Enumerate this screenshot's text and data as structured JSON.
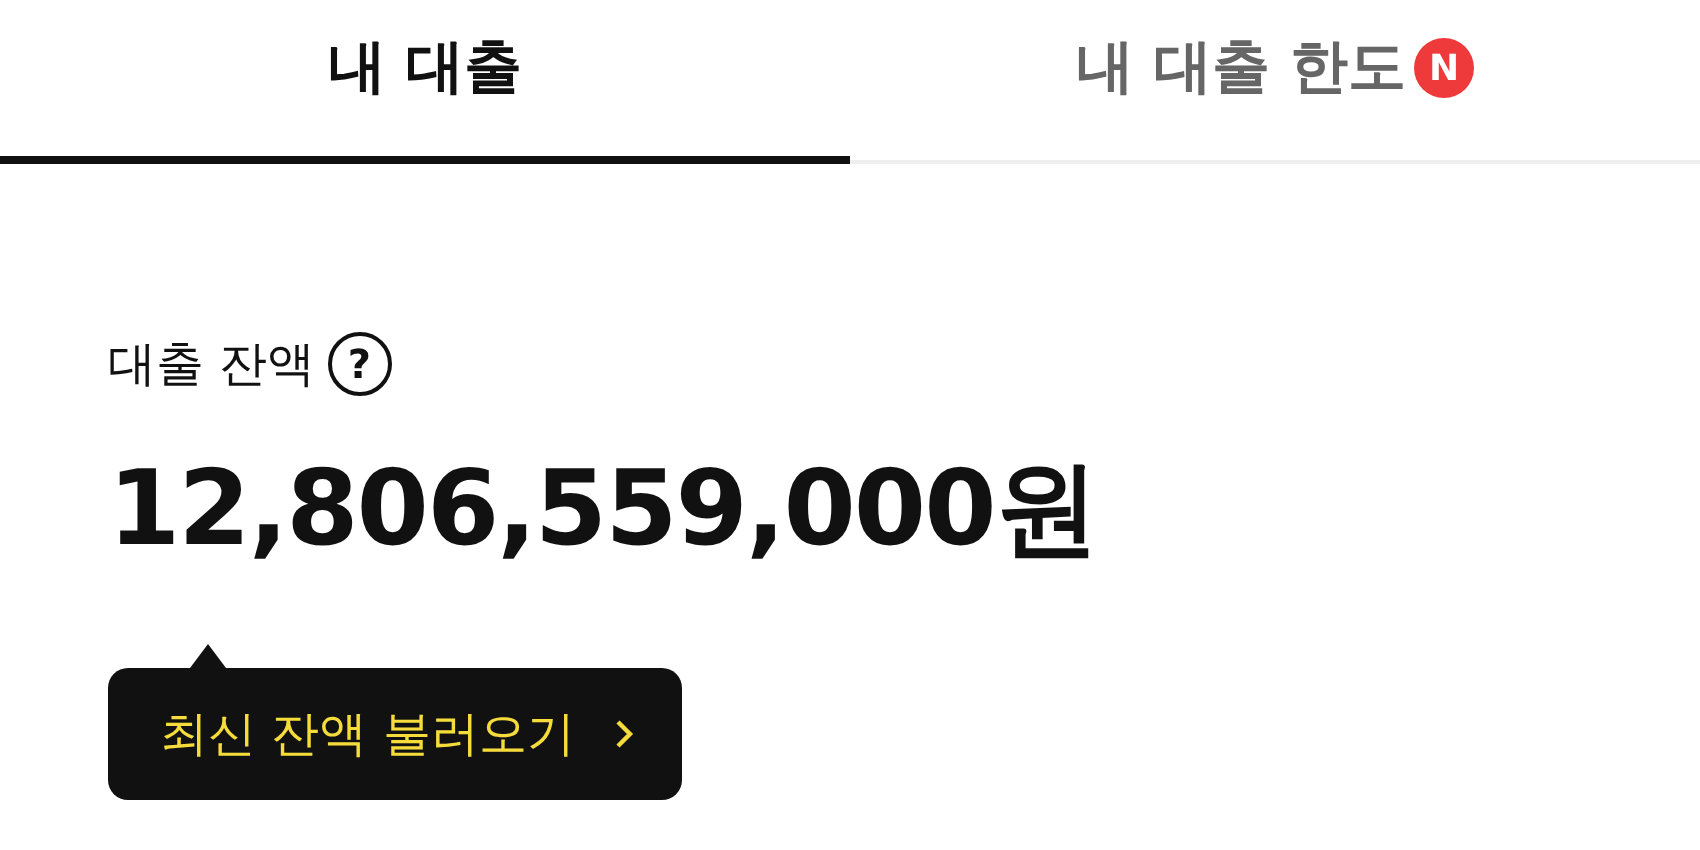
{
  "tabs": [
    {
      "label": "내 대출",
      "selected": true
    },
    {
      "label": "내 대출 한도",
      "selected": false,
      "badge": "N"
    }
  ],
  "balance": {
    "label": "대출 잔액",
    "help": "?",
    "amount": "12,806,559,000원"
  },
  "tooltip": {
    "label": "최신 잔액 불러오기"
  }
}
